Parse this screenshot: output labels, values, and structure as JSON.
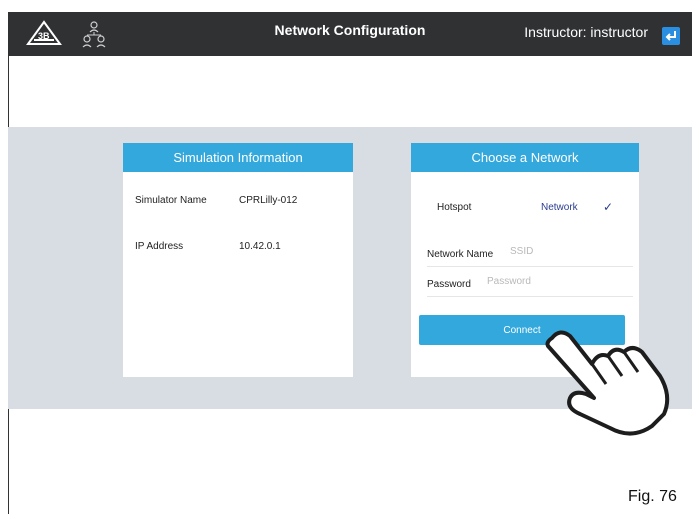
{
  "header": {
    "title": "Network Configuration",
    "instructor": "Instructor: instructor",
    "logo_icon": "3b-logo-icon",
    "network_icon": "network-icon",
    "logout_icon": "logout-icon"
  },
  "simulation_info": {
    "heading": "Simulation Information",
    "rows": [
      {
        "label": "Simulator Name",
        "value": "CPRLilly-012"
      },
      {
        "label": "IP Address",
        "value": "10.42.0.1"
      }
    ]
  },
  "network": {
    "heading": "Choose a Network",
    "hotspot_label": "Hotspot",
    "network_label": "Network",
    "selected": "Network",
    "network_name_label": "Network Name",
    "network_name_placeholder": "SSID",
    "password_label": "Password",
    "password_placeholder": "Password",
    "connect_label": "Connect"
  },
  "figure_label": "Fig. 76",
  "colors": {
    "topbar": "#2f3133",
    "accent": "#33a8dc",
    "band": "#d8dde3",
    "selected_text": "#2a3e8f"
  }
}
